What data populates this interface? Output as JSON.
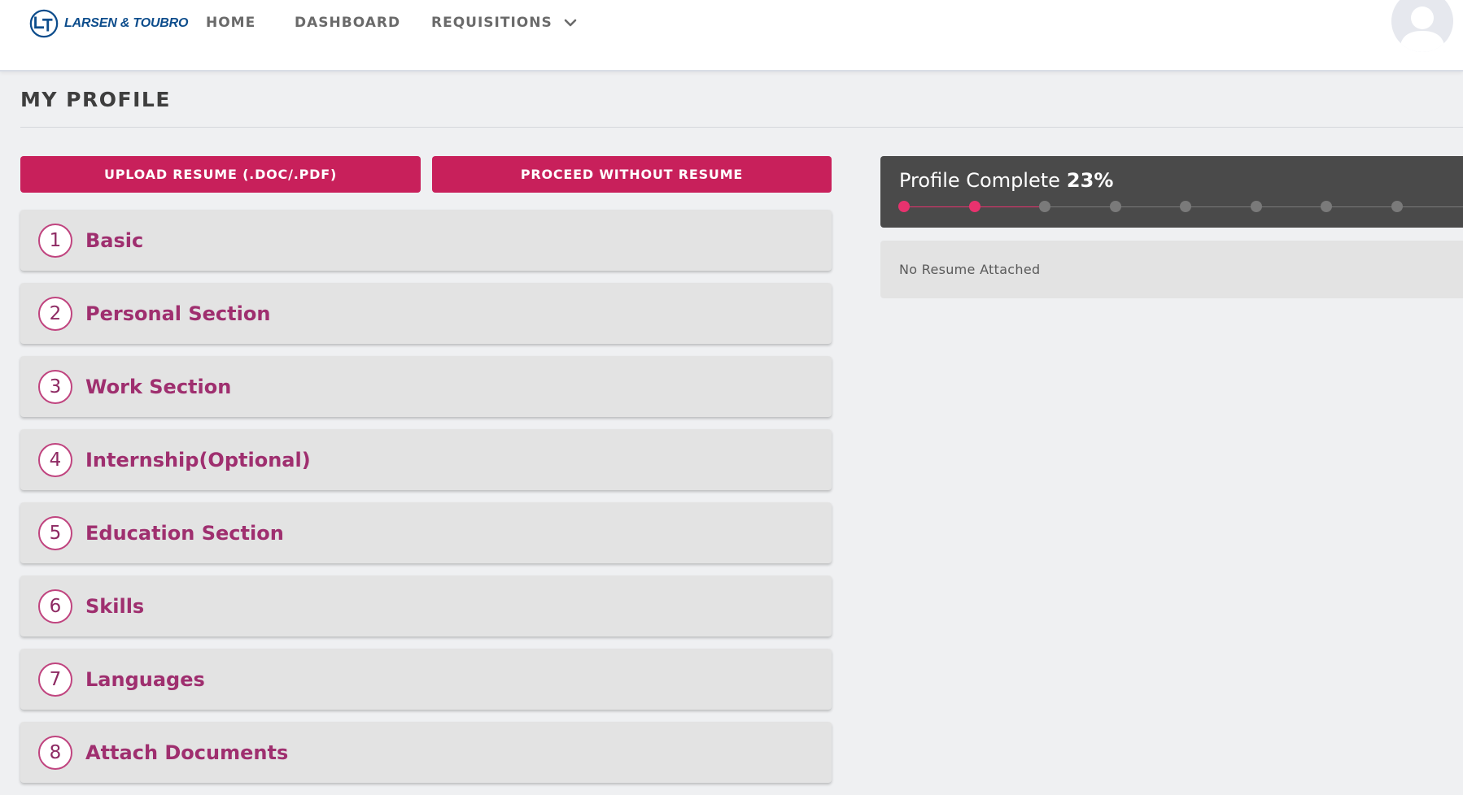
{
  "brand": {
    "name": "LARSEN & TOUBRO",
    "logo_icon": "lt-logo-icon",
    "color": "#0d4d8c"
  },
  "nav": {
    "home": "HOME",
    "dashboard": "DASHBOARD",
    "requisitions": "REQUISITIONS",
    "requisitions_icon": "chevron-down-icon"
  },
  "user": {
    "avatar_icon": "user-avatar-icon"
  },
  "page": {
    "title": "MY PROFILE"
  },
  "actions": {
    "upload_label": "UPLOAD RESUME (.DOC/.PDF)",
    "proceed_label": "PROCEED WITHOUT RESUME",
    "button_color": "#c8205b"
  },
  "sections": [
    {
      "num": "1",
      "label": "Basic"
    },
    {
      "num": "2",
      "label": "Personal Section"
    },
    {
      "num": "3",
      "label": "Work Section"
    },
    {
      "num": "4",
      "label": "Internship(Optional)"
    },
    {
      "num": "5",
      "label": "Education Section"
    },
    {
      "num": "6",
      "label": "Skills"
    },
    {
      "num": "7",
      "label": "Languages"
    },
    {
      "num": "8",
      "label": "Attach Documents"
    }
  ],
  "profile_progress": {
    "label": "Profile Complete",
    "percent_text": "23%",
    "steps_total": 8,
    "steps_completed": 2,
    "accent_color": "#e8326e"
  },
  "resume_status": {
    "text": "No Resume Attached"
  }
}
